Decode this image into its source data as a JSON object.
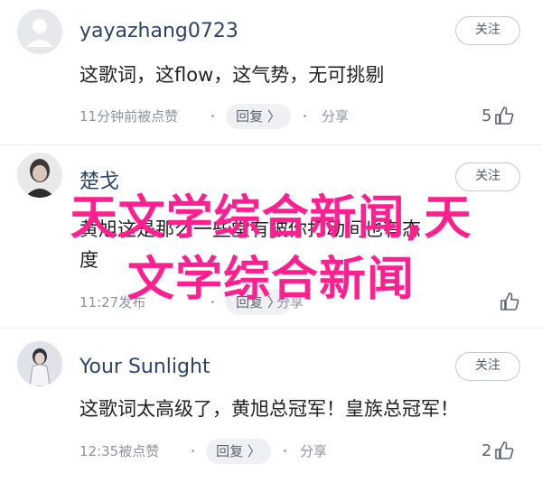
{
  "comments": [
    {
      "username": "yayazhang0723",
      "follow_label": "关注",
      "text": "这歌词，这flow，这气势，无可挑剔",
      "time": "11分钟前被点赞",
      "reply_label": "回复 〉",
      "share_label": "分享",
      "likes": "5"
    },
    {
      "username": "楚戈",
      "follow_label": "关注",
      "text_line1": "黄旭这是那么一些堂有被你打动间也有态",
      "text_line2": "度",
      "time": "11:27发布",
      "reply_label": "回复 〉",
      "share_label": "分享",
      "likes": ""
    },
    {
      "username": "Your Sunlight",
      "follow_label": "关注",
      "text": "这歌词太高级了，黄旭总冠军！皇族总冠军！",
      "time": "12:35被点赞",
      "reply_label": "回复 〉",
      "share_label": "分享",
      "likes": "2"
    }
  ],
  "overlay": {
    "line1": "天文学综合新闻,天",
    "line2": "文学综合新闻",
    "color": "#ff1f8f"
  },
  "icons": {
    "avatar_default": "default-user-icon",
    "like": "thumbs-up-icon"
  }
}
